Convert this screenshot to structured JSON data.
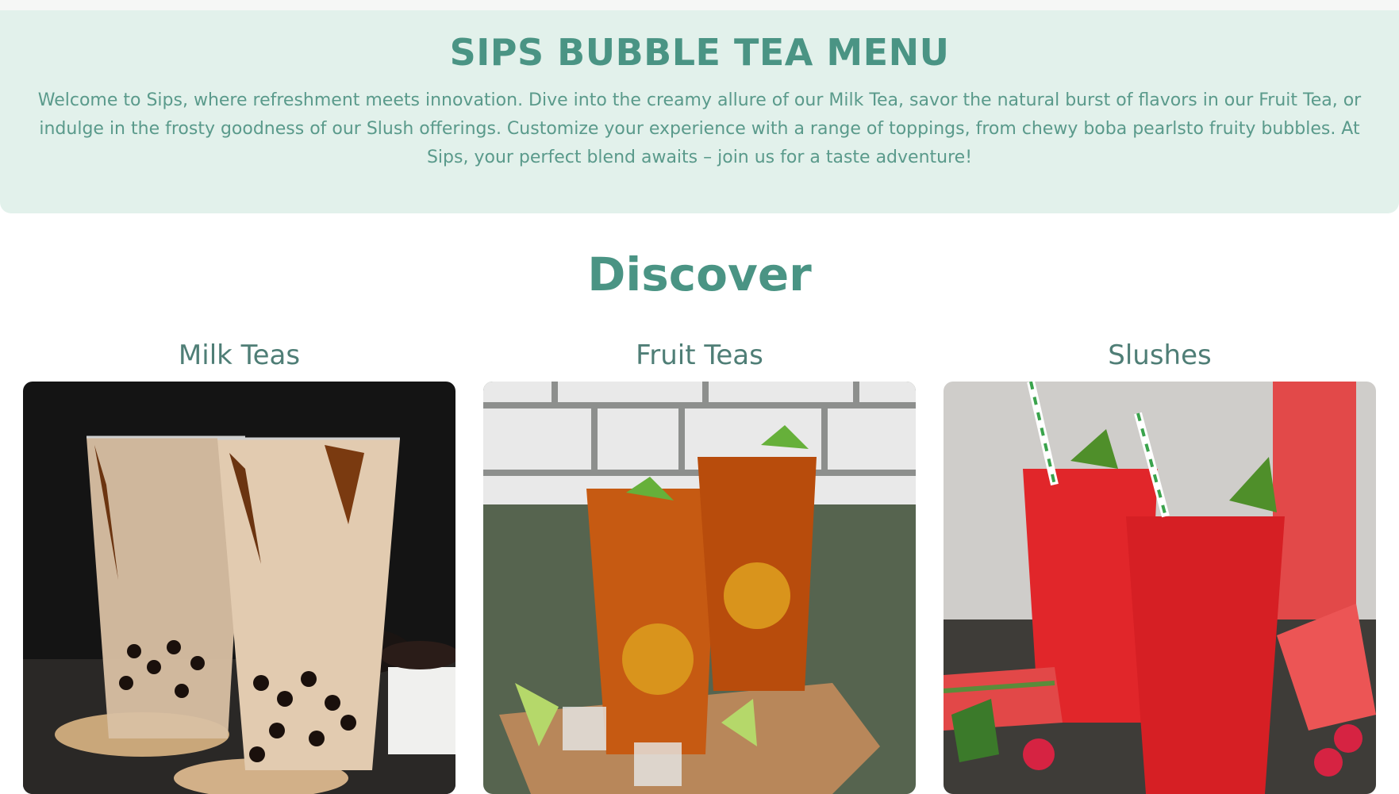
{
  "header": {
    "title": "SIPS BUBBLE TEA MENU",
    "description": "Welcome to Sips, where refreshment meets innovation. Dive into the creamy allure of our Milk Tea, savor the natural burst of flavors in our Fruit Tea, or indulge in the frosty goodness of our Slush offerings. Customize your experience with a range of toppings, from chewy boba pearlsto fruity bubbles. At Sips, your perfect blend awaits – join us for a taste adventure!"
  },
  "discover": {
    "heading": "Discover",
    "categories": [
      {
        "label": "Milk Teas",
        "image": "milk-tea-photo"
      },
      {
        "label": "Fruit Teas",
        "image": "fruit-tea-photo"
      },
      {
        "label": "Slushes",
        "image": "slush-photo"
      }
    ]
  },
  "colors": {
    "hero_background": "#e2f1eb",
    "accent": "#4a9484"
  }
}
